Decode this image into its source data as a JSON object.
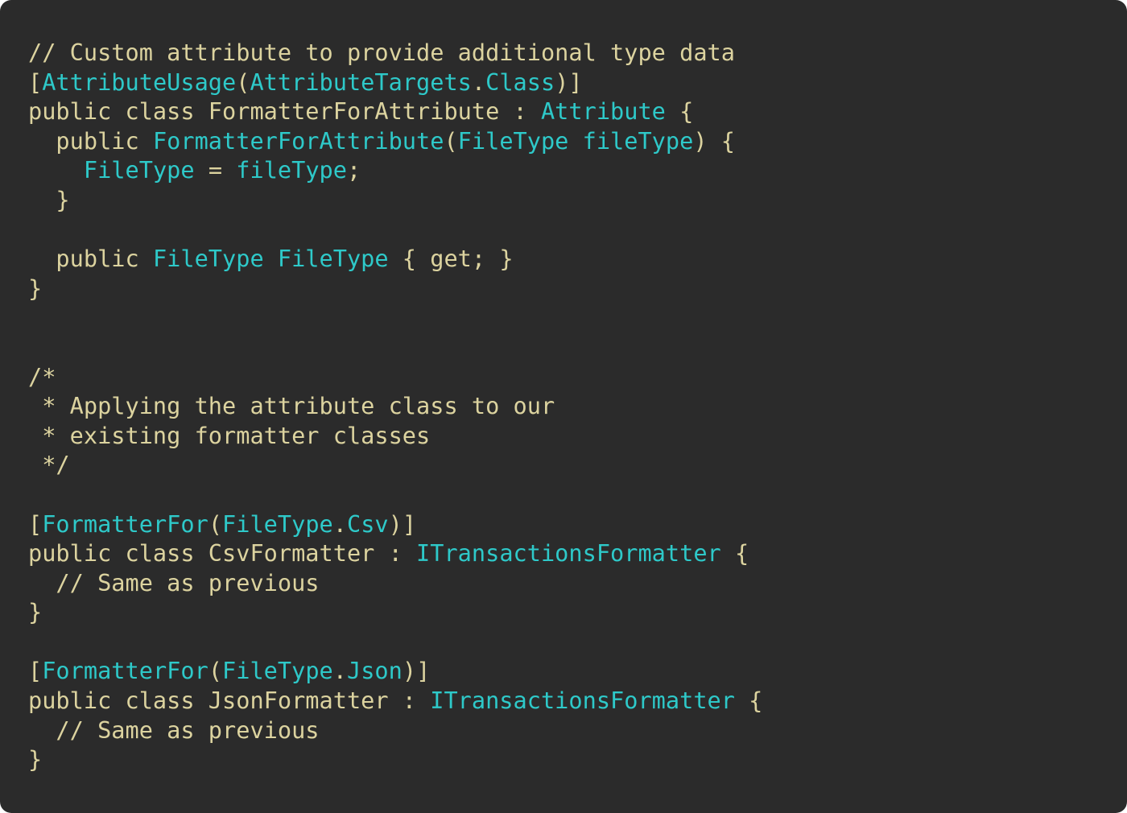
{
  "palette": {
    "background": "#2b2b2b",
    "plain": "#dcd39f",
    "type": "#2ec9c9"
  },
  "code": [
    [
      {
        "t": "// Custom attribute to provide additional type data",
        "c": "plain"
      }
    ],
    [
      {
        "t": "[",
        "c": "plain"
      },
      {
        "t": "AttributeUsage",
        "c": "type"
      },
      {
        "t": "(",
        "c": "plain"
      },
      {
        "t": "AttributeTargets",
        "c": "type"
      },
      {
        "t": ".",
        "c": "plain"
      },
      {
        "t": "Class",
        "c": "type"
      },
      {
        "t": ")]",
        "c": "plain"
      }
    ],
    [
      {
        "t": "public class FormatterForAttribute : ",
        "c": "plain"
      },
      {
        "t": "Attribute",
        "c": "type"
      },
      {
        "t": " {",
        "c": "plain"
      }
    ],
    [
      {
        "t": "  public ",
        "c": "plain"
      },
      {
        "t": "FormatterForAttribute",
        "c": "type"
      },
      {
        "t": "(",
        "c": "plain"
      },
      {
        "t": "FileType fileType",
        "c": "type"
      },
      {
        "t": ") {",
        "c": "plain"
      }
    ],
    [
      {
        "t": "    ",
        "c": "plain"
      },
      {
        "t": "FileType",
        "c": "type"
      },
      {
        "t": " = ",
        "c": "plain"
      },
      {
        "t": "fileType",
        "c": "type"
      },
      {
        "t": ";",
        "c": "plain"
      }
    ],
    [
      {
        "t": "  }",
        "c": "plain"
      }
    ],
    [],
    [
      {
        "t": "  public ",
        "c": "plain"
      },
      {
        "t": "FileType FileType",
        "c": "type"
      },
      {
        "t": " { get; }",
        "c": "plain"
      }
    ],
    [
      {
        "t": "}",
        "c": "plain"
      }
    ],
    [],
    [],
    [
      {
        "t": "/*",
        "c": "plain"
      }
    ],
    [
      {
        "t": " * Applying the attribute class to our",
        "c": "plain"
      }
    ],
    [
      {
        "t": " * existing formatter classes",
        "c": "plain"
      }
    ],
    [
      {
        "t": " */",
        "c": "plain"
      }
    ],
    [],
    [
      {
        "t": "[",
        "c": "plain"
      },
      {
        "t": "FormatterFor",
        "c": "type"
      },
      {
        "t": "(",
        "c": "plain"
      },
      {
        "t": "FileType",
        "c": "type"
      },
      {
        "t": ".",
        "c": "plain"
      },
      {
        "t": "Csv",
        "c": "type"
      },
      {
        "t": ")]",
        "c": "plain"
      }
    ],
    [
      {
        "t": "public class CsvFormatter : ",
        "c": "plain"
      },
      {
        "t": "ITransactionsFormatter",
        "c": "type"
      },
      {
        "t": " {",
        "c": "plain"
      }
    ],
    [
      {
        "t": "  // Same as previous",
        "c": "plain"
      }
    ],
    [
      {
        "t": "}",
        "c": "plain"
      }
    ],
    [],
    [
      {
        "t": "[",
        "c": "plain"
      },
      {
        "t": "FormatterFor",
        "c": "type"
      },
      {
        "t": "(",
        "c": "plain"
      },
      {
        "t": "FileType",
        "c": "type"
      },
      {
        "t": ".",
        "c": "plain"
      },
      {
        "t": "Json",
        "c": "type"
      },
      {
        "t": ")]",
        "c": "plain"
      }
    ],
    [
      {
        "t": "public class JsonFormatter : ",
        "c": "plain"
      },
      {
        "t": "ITransactionsFormatter",
        "c": "type"
      },
      {
        "t": " {",
        "c": "plain"
      }
    ],
    [
      {
        "t": "  // Same as previous",
        "c": "plain"
      }
    ],
    [
      {
        "t": "}",
        "c": "plain"
      }
    ]
  ]
}
